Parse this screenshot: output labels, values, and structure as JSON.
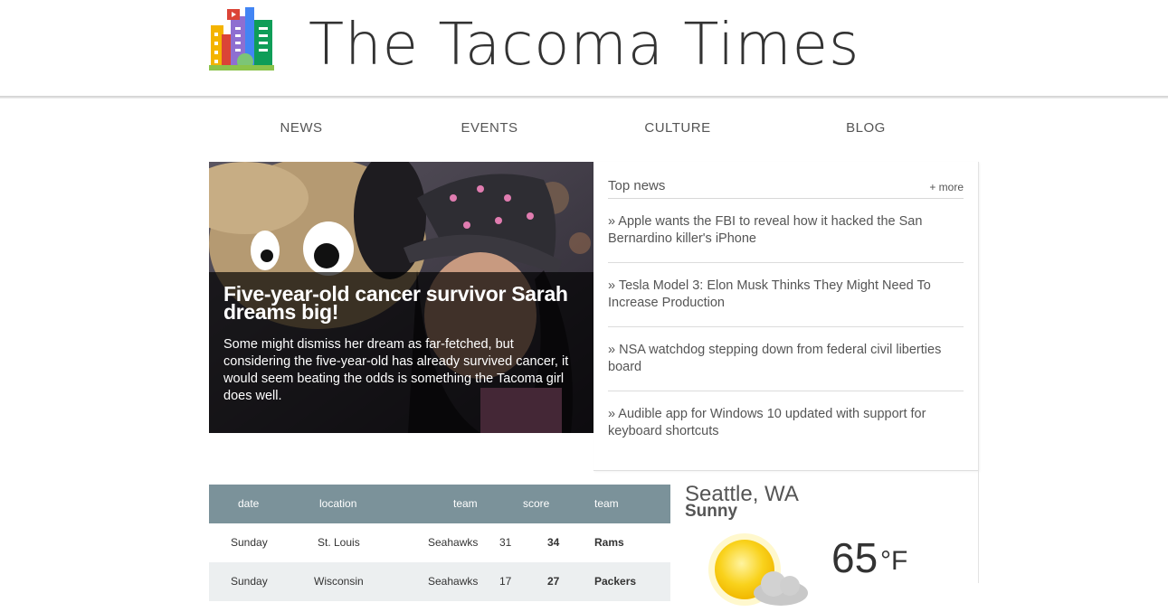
{
  "site": {
    "title": "The Tacoma Times"
  },
  "nav": {
    "items": [
      "NEWS",
      "EVENTS",
      "CULTURE",
      "BLOG"
    ]
  },
  "hero": {
    "title": "Five-year-old cancer survivor Sarah dreams big!",
    "text": "Some might dismiss her dream as far-fetched, but considering the five-year-old has already survived cancer, it would seem beating the odds is something the Tacoma girl does well."
  },
  "topnews": {
    "title": "Top news",
    "more": "+ more",
    "items": [
      "» Apple wants the FBI to reveal how it hacked the San Bernardino killer's iPhone",
      "» Tesla Model 3: Elon Musk Thinks They Might Need To Increase Production",
      "» NSA watchdog stepping down from federal civil liberties board",
      "» Audible app for Windows 10 updated with support for keyboard shortcuts"
    ]
  },
  "scores": {
    "headers": [
      "date",
      "location",
      "team",
      "score",
      "team"
    ],
    "rows": [
      [
        "Sunday",
        "St. Louis",
        "Seahawks",
        "31",
        "34",
        "Rams"
      ],
      [
        "Sunday",
        "Wisconsin",
        "Seahawks",
        "17",
        "27",
        "Packers"
      ]
    ],
    "head_color": "#7b929a",
    "alt_row_color": "#eceff0"
  },
  "weather": {
    "city": "Seattle, WA",
    "condition": "Sunny",
    "temp": "65",
    "unit": "°F",
    "icon": "partly-sunny-icon"
  },
  "hero_photo": {
    "icon": "hero-photo"
  }
}
